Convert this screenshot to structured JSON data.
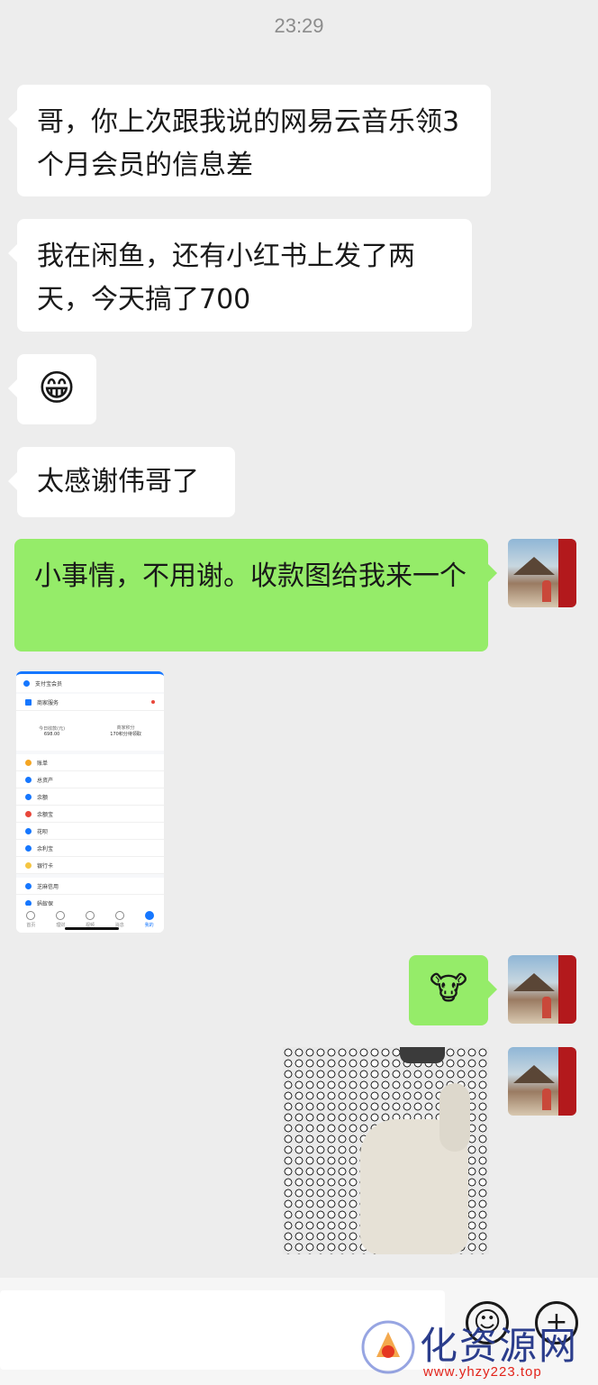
{
  "header": {
    "time": "23:29"
  },
  "messages": [
    {
      "side": "in",
      "type": "text",
      "text": "哥，你上次跟我说的网易云音乐领3个月会员的信息差"
    },
    {
      "side": "in",
      "type": "text",
      "text": "我在闲鱼，还有小红书上发了两天，今天搞了700"
    },
    {
      "side": "in",
      "type": "emoji",
      "text": "😁"
    },
    {
      "side": "in",
      "type": "text",
      "text": "太感谢伟哥了"
    },
    {
      "side": "out",
      "type": "text",
      "text": "小事情，不用谢。收款图给我来一个"
    },
    {
      "side": "in",
      "type": "image",
      "kind": "phone-screenshot"
    },
    {
      "side": "out",
      "type": "emoji",
      "text": "🐮"
    },
    {
      "side": "out",
      "type": "image",
      "kind": "photo"
    }
  ],
  "shared_screenshot": {
    "title": "支付宝会员",
    "title_badge": "",
    "merchant_label": "商家服务",
    "stat_left_label": "今日收款(元)",
    "stat_left_value": "698.00",
    "stat_right_label": "商家积分",
    "stat_right_value": "170积分待领取",
    "items": [
      {
        "label": "账单",
        "color": "#f5a623"
      },
      {
        "label": "总资产",
        "color": "#1677ff"
      },
      {
        "label": "余额",
        "color": "#1677ff"
      },
      {
        "label": "余额宝",
        "color": "#e8473b"
      },
      {
        "label": "花呗",
        "color": "#1677ff"
      },
      {
        "label": "余利宝",
        "color": "#1677ff"
      },
      {
        "label": "银行卡",
        "color": "#f5c542"
      },
      {
        "label": "芝麻信用",
        "color": "#1677ff"
      },
      {
        "label": "蚂蚁保",
        "color": "#1677ff"
      }
    ],
    "tabs": [
      "首页",
      "理财",
      "视频",
      "消息",
      "我的"
    ]
  },
  "input_bar": {
    "emoji_button": "☺",
    "plus_button": "+"
  },
  "watermark": {
    "text": "化资源网",
    "url": "www.yhzy223.top"
  }
}
